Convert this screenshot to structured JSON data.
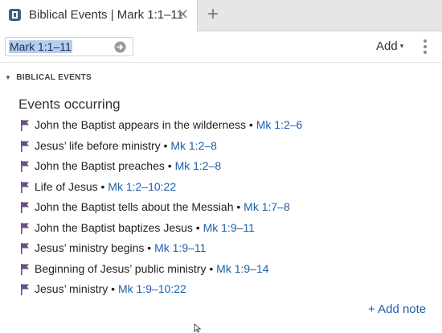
{
  "tab": {
    "title": "Biblical Events | Mark 1:1–11",
    "close_glyph": "✕",
    "new_tab_glyph": "+"
  },
  "toolbar": {
    "reference": "Mark 1:1–11",
    "add_label": "Add",
    "add_caret": "▾"
  },
  "section": {
    "caret": "▼",
    "title": "BIBLICAL EVENTS"
  },
  "events_heading": "Events occurring",
  "events": [
    {
      "name": "John the Baptist appears in the wilderness",
      "ref": "Mk 1:2–6"
    },
    {
      "name": "Jesus’ life before ministry",
      "ref": "Mk 1:2–8"
    },
    {
      "name": "John the Baptist preaches",
      "ref": "Mk 1:2–8"
    },
    {
      "name": "Life of Jesus",
      "ref": "Mk 1:2–10:22"
    },
    {
      "name": "John the Baptist tells about the Messiah",
      "ref": "Mk 1:7–8"
    },
    {
      "name": "John the Baptist baptizes Jesus",
      "ref": "Mk 1:9–11"
    },
    {
      "name": "Jesus’ ministry begins",
      "ref": "Mk 1:9–11"
    },
    {
      "name": "Beginning of Jesus’ public ministry",
      "ref": "Mk 1:9–14"
    },
    {
      "name": "Jesus’ ministry",
      "ref": "Mk 1:9–10:22"
    }
  ],
  "separator": " • ",
  "add_note_label": "+ Add note",
  "colors": {
    "link": "#1f5fa8",
    "flag": "#6b4c8a",
    "selection": "#b5cdef"
  },
  "icons": {
    "tab": "book-icon",
    "go": "go-arrow-icon",
    "event": "flag-icon",
    "menu": "more-vertical-icon"
  }
}
